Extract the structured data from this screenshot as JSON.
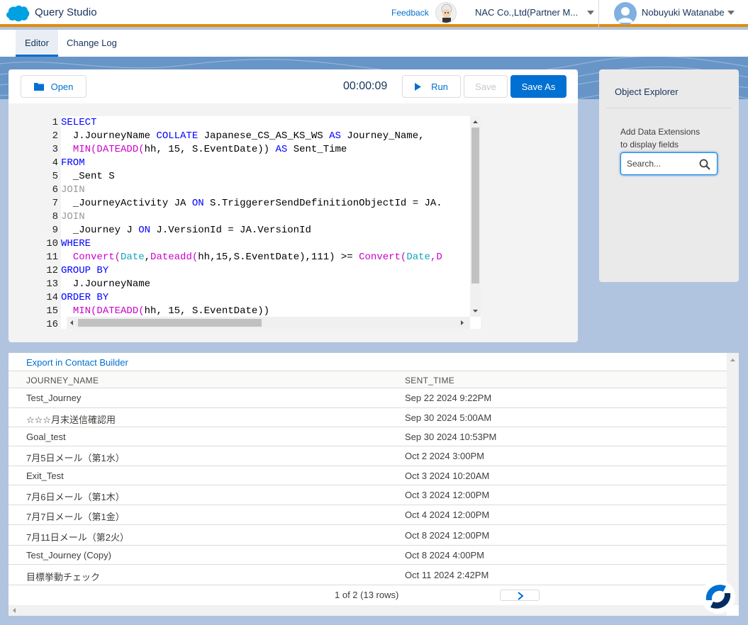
{
  "header": {
    "app_title": "Query Studio",
    "feedback": "Feedback",
    "org_name": "NAC Co.,Ltd(Partner M...",
    "user_name": "Nobuyuki Watanabe"
  },
  "tabs": [
    {
      "label": "Editor",
      "active": true
    },
    {
      "label": "Change Log",
      "active": false
    }
  ],
  "toolbar": {
    "open_label": "Open",
    "timer": "00:00:09",
    "run_label": "Run",
    "save_label": "Save",
    "save_as_label": "Save As"
  },
  "editor": {
    "line_numbers": [
      "1",
      "2",
      "3",
      "4",
      "5",
      "6",
      "7",
      "8",
      "9",
      "10",
      "11",
      "12",
      "13",
      "14",
      "15",
      "16"
    ],
    "lines": [
      [
        {
          "t": "SELECT",
          "c": "kw"
        }
      ],
      [
        {
          "t": "  J.JourneyName ",
          "c": ""
        },
        {
          "t": "COLLATE",
          "c": "kw"
        },
        {
          "t": " Japanese_CS_AS_KS_WS ",
          "c": ""
        },
        {
          "t": "AS",
          "c": "kw"
        },
        {
          "t": " Journey_Name,",
          "c": ""
        }
      ],
      [
        {
          "t": "  ",
          "c": ""
        },
        {
          "t": "MIN(DATEADD(",
          "c": "fn"
        },
        {
          "t": "hh, 15, S.EventDate)) ",
          "c": ""
        },
        {
          "t": "AS",
          "c": "kw"
        },
        {
          "t": " Sent_Time",
          "c": ""
        }
      ],
      [
        {
          "t": "FROM",
          "c": "kw"
        }
      ],
      [
        {
          "t": "  _Sent S",
          "c": ""
        }
      ],
      [
        {
          "t": "JOIN",
          "c": "cm"
        }
      ],
      [
        {
          "t": "  _JourneyActivity JA ",
          "c": ""
        },
        {
          "t": "ON",
          "c": "kw"
        },
        {
          "t": " S.TriggererSendDefinitionObjectId = JA.",
          "c": ""
        }
      ],
      [
        {
          "t": "JOIN",
          "c": "cm"
        }
      ],
      [
        {
          "t": "  _Journey J ",
          "c": ""
        },
        {
          "t": "ON",
          "c": "kw"
        },
        {
          "t": " J.VersionId = JA.VersionId",
          "c": ""
        }
      ],
      [
        {
          "t": "WHERE",
          "c": "kw"
        }
      ],
      [
        {
          "t": "  ",
          "c": ""
        },
        {
          "t": "Convert(",
          "c": "fn"
        },
        {
          "t": "Date",
          "c": "ty"
        },
        {
          "t": ",",
          "c": ""
        },
        {
          "t": "Dateadd(",
          "c": "fn"
        },
        {
          "t": "hh,15,S.EventDate),111) >= ",
          "c": ""
        },
        {
          "t": "Convert(",
          "c": "fn"
        },
        {
          "t": "Date",
          "c": "ty"
        },
        {
          "t": ",D",
          "c": "fn"
        }
      ],
      [
        {
          "t": "GROUP BY",
          "c": "kw"
        }
      ],
      [
        {
          "t": "  J.JourneyName",
          "c": ""
        }
      ],
      [
        {
          "t": "ORDER BY",
          "c": "kw"
        }
      ],
      [
        {
          "t": "  ",
          "c": ""
        },
        {
          "t": "MIN(DATEADD(",
          "c": "fn"
        },
        {
          "t": "hh, 15, S.EventDate))",
          "c": ""
        }
      ],
      [
        {
          "t": "",
          "c": ""
        }
      ]
    ]
  },
  "object_explorer": {
    "title": "Object Explorer",
    "hint_line1": "Add Data Extensions",
    "hint_line2": "to display fields",
    "search_placeholder": "Search..."
  },
  "results": {
    "export_label": "Export in Contact Builder",
    "columns": [
      "JOURNEY_NAME",
      "SENT_TIME"
    ],
    "rows": [
      [
        "Test_Journey",
        "Sep 22 2024 9:22PM"
      ],
      [
        "☆☆☆月末送信確認用",
        "Sep 30 2024 5:00AM"
      ],
      [
        "Goal_test",
        "Sep 30 2024 10:53PM"
      ],
      [
        "7月5日メール（第1水）",
        "Oct 2 2024 3:00PM"
      ],
      [
        "Exit_Test",
        "Oct 3 2024 10:20AM"
      ],
      [
        "7月6日メール（第1木）",
        "Oct 3 2024 12:00PM"
      ],
      [
        "7月7日メール（第1金）",
        "Oct 4 2024 12:00PM"
      ],
      [
        "7月11日メール（第2火）",
        "Oct 8 2024 12:00PM"
      ],
      [
        "Test_Journey (Copy)",
        "Oct 8 2024 4:00PM"
      ],
      [
        "目標挙動チェック",
        "Oct 11 2024 2:42PM"
      ]
    ],
    "pager": "1 of 2 (13 rows)"
  },
  "colors": {
    "brand": "#0070d2",
    "header_accent": "#e38b0c",
    "background": "#b0c4df"
  }
}
